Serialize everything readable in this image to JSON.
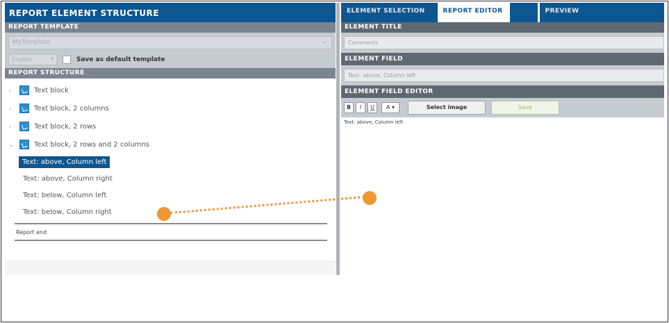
{
  "left": {
    "title": "REPORT ELEMENT STRUCTURE",
    "template_header": "REPORT TEMPLATE",
    "template_value": "MyTemplate",
    "language_value": "English",
    "default_checkbox_label": "Save as default template",
    "structure_header": "REPORT STRUCTURE",
    "tree": [
      {
        "label": "Text block"
      },
      {
        "label": "Text block, 2 columns"
      },
      {
        "label": "Text block, 2 rows"
      },
      {
        "label": "Text block, 2 rows and 2 columns"
      }
    ],
    "children": [
      {
        "label": "Text: above, Column left"
      },
      {
        "label": "Text: above, Column right"
      },
      {
        "label": "Text: below, Column left"
      },
      {
        "label": "Text: below, Column right"
      }
    ],
    "report_end": "Report end"
  },
  "right": {
    "tabs": [
      "ELEMENT SELECTION",
      "REPORT EDITOR",
      "PREVIEW"
    ],
    "active_tab": "REPORT EDITOR",
    "element_title_header": "ELEMENT TITLE",
    "element_title_value": "Comments",
    "element_field_header": "ELEMENT FIELD",
    "element_field_value": "Text: above, Column left",
    "editor_header": "ELEMENT FIELD EDITOR",
    "toolbar": {
      "bold": "B",
      "italic": "I",
      "underline": "U",
      "color": "A ▾",
      "select_image": "Select image",
      "save": "Save"
    },
    "editor_text": "Text: above, Column left"
  },
  "icons": {
    "expand": "expand-arrow-icon",
    "node": "text-block-icon",
    "dropdown": "chevron-down-icon"
  },
  "colors": {
    "header_blue": "#0e5690",
    "annotation_orange": "#ef9635"
  }
}
